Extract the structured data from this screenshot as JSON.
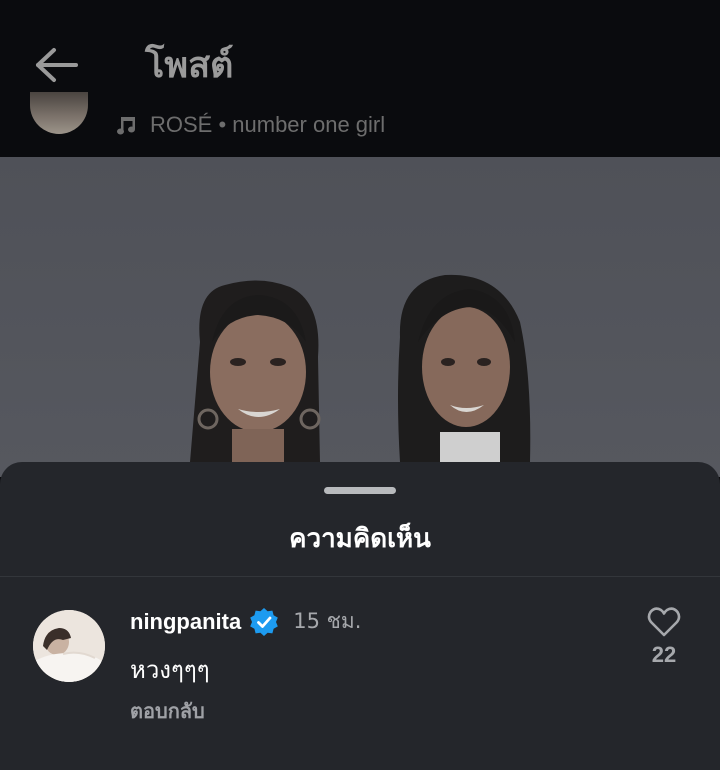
{
  "header": {
    "title": "โพสต์",
    "back_icon": "arrow-left-icon"
  },
  "post": {
    "music": {
      "icon": "music-note-icon",
      "text": "ROSÉ • number one girl"
    }
  },
  "comments_sheet": {
    "title": "ความคิดเห็น",
    "comments": [
      {
        "username": "ningpanita",
        "verified": true,
        "time": "15 ชม.",
        "text": "หวงๆๆๆ",
        "reply_label": "ตอบกลับ",
        "likes": "22"
      }
    ]
  },
  "colors": {
    "sheet_bg": "#24262b",
    "verified_badge": "#1d9bf0",
    "muted_text": "#a6a8ac"
  }
}
